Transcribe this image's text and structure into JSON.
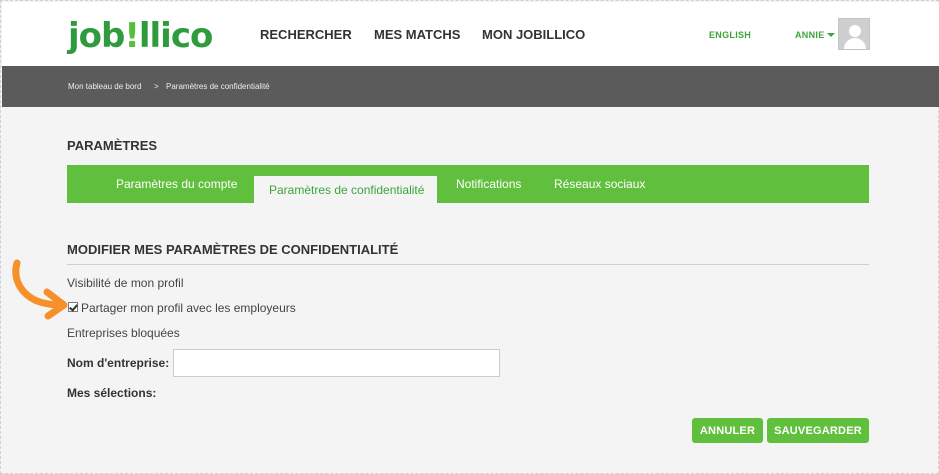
{
  "colors": {
    "brand_green": "#61bf3e",
    "dark_green": "#2e9b3c",
    "breadcrumb_bg": "#5b5b5b",
    "annotation_orange": "#f5902a"
  },
  "header": {
    "logo": {
      "part1": "job",
      "part2": "!",
      "part3": "llico"
    },
    "nav": [
      {
        "label": "RECHERCHER"
      },
      {
        "label": "MES MATCHS"
      },
      {
        "label": "MON JOBILLICO"
      }
    ],
    "language_link": "ENGLISH",
    "user_name": "ANNIE",
    "avatar_icon": "user-silhouette-icon"
  },
  "breadcrumb": {
    "items": [
      "Mon tableau de bord",
      "Paramètres de confidentialité"
    ],
    "separator": ">"
  },
  "page": {
    "title": "PARAMÈTRES",
    "tabs": [
      {
        "label": "Paramètres du compte",
        "active": false
      },
      {
        "label": "Paramètres de confidentialité",
        "active": true
      },
      {
        "label": "Notifications",
        "active": false
      },
      {
        "label": "Réseaux sociaux",
        "active": false
      }
    ]
  },
  "privacy": {
    "heading": "MODIFIER MES PARAMÈTRES DE CONFIDENTIALITÉ",
    "visibility_label": "Visibilité de mon profil",
    "share_checkbox": {
      "label": "Partager mon profil avec les employeurs",
      "checked": true
    },
    "blocked_label": "Entreprises bloquées",
    "company_field": {
      "label": "Nom d'entreprise:",
      "value": "",
      "placeholder": ""
    },
    "selections_label": "Mes sélections:"
  },
  "actions": {
    "cancel": "ANNULER",
    "save": "SAUVEGARDER"
  },
  "annotation": {
    "icon": "curved-arrow-icon"
  }
}
